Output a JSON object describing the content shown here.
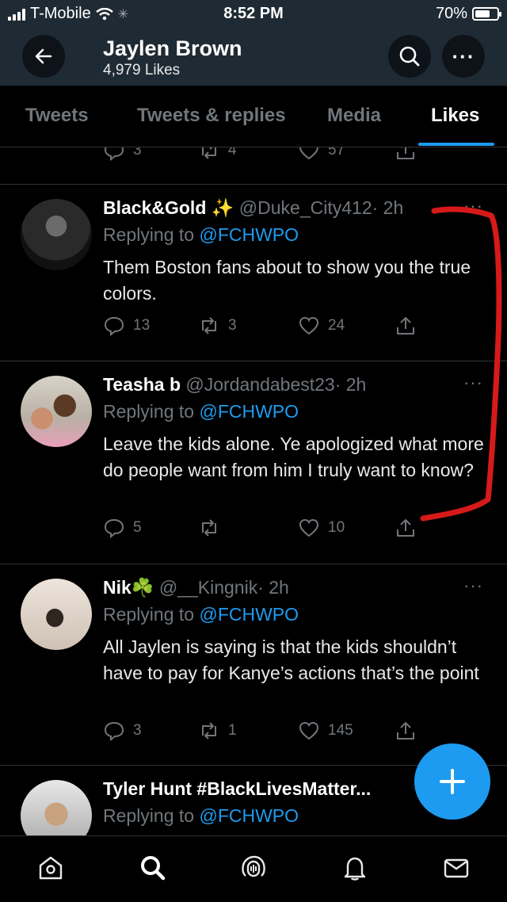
{
  "status_bar": {
    "carrier": "T-Mobile",
    "time": "8:52 PM",
    "battery": "70%",
    "battery_level": 0.7
  },
  "header": {
    "name": "Jaylen Brown",
    "likes": "4,979 Likes",
    "more_icon": "···"
  },
  "tabs": [
    {
      "label": "Tweets",
      "active": false
    },
    {
      "label": "Tweets & replies",
      "active": false
    },
    {
      "label": "Media",
      "active": false
    },
    {
      "label": "Likes",
      "active": true
    }
  ],
  "partial_tweet": {
    "replies": "3",
    "retweets": "4",
    "likes": "57"
  },
  "tweets": [
    {
      "name": "Black&Gold",
      "name_emoji": "✨",
      "handle": "@Duke_City412",
      "time": "· 2h",
      "replying_prefix": "Replying to ",
      "replying_to": "@FCHWPO",
      "text": "Them Boston fans about to show you the true colors.",
      "replies": "13",
      "retweets": "3",
      "likes": "24"
    },
    {
      "name": "Teasha b",
      "handle": "@Jordandabest23",
      "time": "· 2h",
      "replying_prefix": "Replying to ",
      "replying_to": "@FCHWPO",
      "text": "Leave the kids alone. Ye apologized what more do people want from him I truly want to know?",
      "replies": "5",
      "retweets": "",
      "likes": "10"
    },
    {
      "name": "Nik",
      "name_emoji": "☘️",
      "handle": "@__Kingnik",
      "time": "· 2h",
      "replying_prefix": "Replying to ",
      "replying_to": "@FCHWPO",
      "text": "All Jaylen is saying is that the kids shouldn’t have to pay for Kanye’s actions that’s the point",
      "replies": "3",
      "retweets": "1",
      "likes": "145"
    },
    {
      "name": "Tyler Hunt #BlackLivesMatter...",
      "handle": "",
      "time": "",
      "replying_prefix": "Replying to ",
      "replying_to": "@FCHWPO"
    }
  ],
  "colors": {
    "accent": "#1d9bf0",
    "header_bg": "#1f2b34",
    "muted": "#71767b",
    "annotation": "#d61a1a"
  },
  "nav_icons": [
    "home-icon",
    "search-icon",
    "spaces-icon",
    "notifications-icon",
    "messages-icon"
  ]
}
